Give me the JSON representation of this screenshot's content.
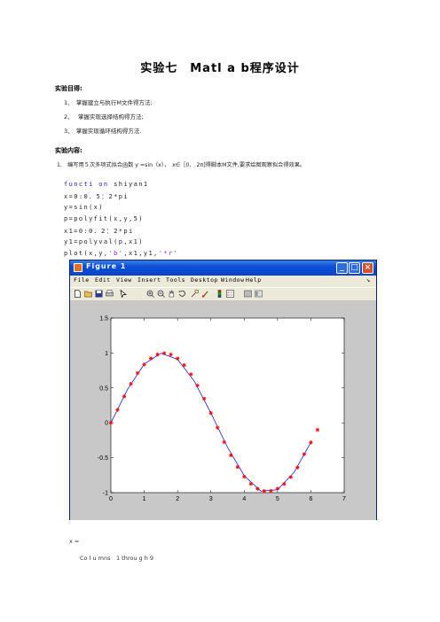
{
  "title": "实验七　Matl a b程序设计",
  "purpose_heading": "实验目得:",
  "purpose_items": [
    "1、　掌握建立与执行M文件得方法;",
    "2、　 掌握实现选择结构得方法;",
    "3、　掌握实现循环结构得方法."
  ],
  "content_heading": "实验内容:",
  "task": "1.　编写用５次多项式拟合函数 y =sin（x），　x∈［0,　2π]得脚本M文件,要求绘图观察拟合得效果。",
  "code": {
    "line1_kw": "functi on",
    "line1_rest": " shiyan1",
    "line2": "x=0:0．5：2*pi",
    "line3": "y=sin(x)",
    "line4": "p=polyfit(x,y,5)",
    "line5": "x1=0:0．2：2*pi",
    "line6": "y1=polyval(p,x1)",
    "line7_pre": "plot(x,y,",
    "line7_s1": "'b'",
    "line7_mid": ",x1,y1,",
    "line7_s2": "'*r'"
  },
  "figure": {
    "window_title": "Figure 1",
    "menus": [
      "File",
      "Edit",
      "View",
      "Insert",
      "Tools",
      "Desktop",
      "Window",
      "Help"
    ],
    "toolbar_icons": [
      "new-file-icon",
      "open-folder-icon",
      "save-icon",
      "print-icon",
      "pointer-icon",
      "zoom-in-icon",
      "zoom-out-icon",
      "pan-hand-icon",
      "rotate-icon",
      "data-cursor-icon",
      "brush-icon",
      "colorbar-icon",
      "legend-icon",
      "hide-plot-tools-icon",
      "show-plot-tools-icon"
    ]
  },
  "chart_data": {
    "type": "line",
    "xlim": [
      0,
      7
    ],
    "ylim": [
      -1,
      1.5
    ],
    "xticks": [
      0,
      1,
      2,
      3,
      4,
      5,
      6,
      7
    ],
    "yticks": [
      -1,
      -0.5,
      0,
      0.5,
      1,
      1.5
    ],
    "ytick_labels": [
      "-1",
      "-0.5",
      "0",
      "0.5",
      "1",
      "1.5"
    ],
    "series": [
      {
        "style": "line",
        "color": "#0000ff",
        "x": [
          0,
          0.5,
          1.0,
          1.5,
          2.0,
          2.5,
          3.0,
          3.5,
          4.0,
          4.5,
          5.0,
          5.5,
          6.0
        ],
        "y": [
          0,
          0.479,
          0.841,
          0.997,
          0.909,
          0.598,
          0.141,
          -0.351,
          -0.757,
          -0.978,
          -0.959,
          -0.706,
          -0.279
        ]
      },
      {
        "style": "star",
        "color": "#ff0000",
        "x": [
          0,
          0.2,
          0.4,
          0.6,
          0.8,
          1.0,
          1.2,
          1.4,
          1.6,
          1.8,
          2.0,
          2.2,
          2.4,
          2.6,
          2.8,
          3.0,
          3.2,
          3.4,
          3.6,
          3.8,
          4.0,
          4.2,
          4.4,
          4.6,
          4.8,
          5.0,
          5.2,
          5.4,
          5.6,
          5.8,
          6.0,
          6.2
        ],
        "y": [
          0.0,
          0.185,
          0.379,
          0.559,
          0.713,
          0.836,
          0.924,
          0.978,
          0.997,
          0.978,
          0.921,
          0.826,
          0.696,
          0.534,
          0.346,
          0.14,
          -0.071,
          -0.276,
          -0.466,
          -0.633,
          -0.771,
          -0.875,
          -0.944,
          -0.977,
          -0.975,
          -0.941,
          -0.876,
          -0.778,
          -0.64,
          -0.45,
          -0.28,
          -0.1
        ]
      }
    ]
  },
  "output": {
    "var": "x =",
    "columns": "Co l u mns　1 throu g h 9"
  }
}
